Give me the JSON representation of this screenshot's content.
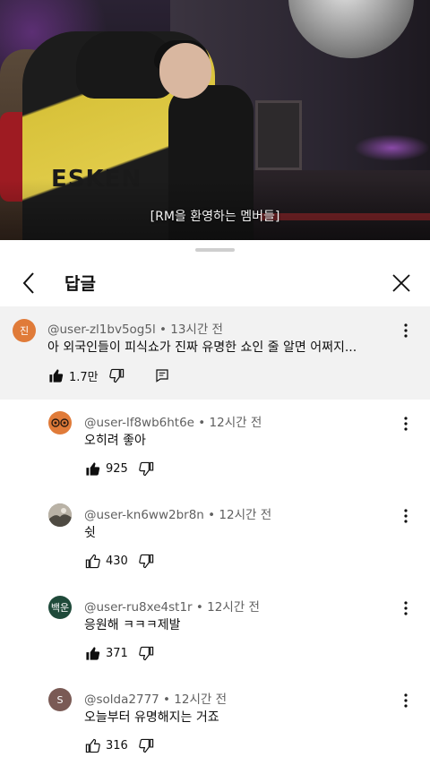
{
  "video": {
    "subtitle": "[RM을 환영하는 멤버들]",
    "jacket_text": "ESKEN"
  },
  "sheet": {
    "title": "답글"
  },
  "parent_comment": {
    "author": "@user-zl1bv5og5l",
    "time": "13시간 전",
    "avatar_text": "진",
    "avatar_color": "#e07b39",
    "text": "아 외국인들이  피식쇼가 진짜 유명한 쇼인 줄 알면 어쩌지...",
    "likes": "1.7만",
    "liked": true
  },
  "replies": [
    {
      "author": "@user-lf8wb6ht6e",
      "time": "12시간 전",
      "avatar_text": "",
      "avatar_color": "#e07b39",
      "avatar_icon": "eyes-icon",
      "text": "오히려 좋아",
      "likes": "925",
      "liked": true
    },
    {
      "author": "@user-kn6ww2br8n",
      "time": "12시간 전",
      "avatar_text": "",
      "avatar_color": "#8a8070",
      "avatar_icon": "photo-avatar",
      "text": "쉿",
      "likes": "430",
      "liked": false
    },
    {
      "author": "@user-ru8xe4st1r",
      "time": "12시간 전",
      "avatar_text": "백운",
      "avatar_color": "#1f4a3a",
      "text": "응원해 ㅋㅋㅋ제발",
      "likes": "371",
      "liked": true
    },
    {
      "author": "@solda2777",
      "time": "12시간 전",
      "avatar_text": "S",
      "avatar_color": "#7a5a55",
      "text": "오늘부터 유명해지는 거죠",
      "likes": "316",
      "liked": false
    }
  ],
  "colors": {
    "highlight_bg": "#f2f2f2",
    "meta": "#606060",
    "text": "#0f0f0f"
  }
}
